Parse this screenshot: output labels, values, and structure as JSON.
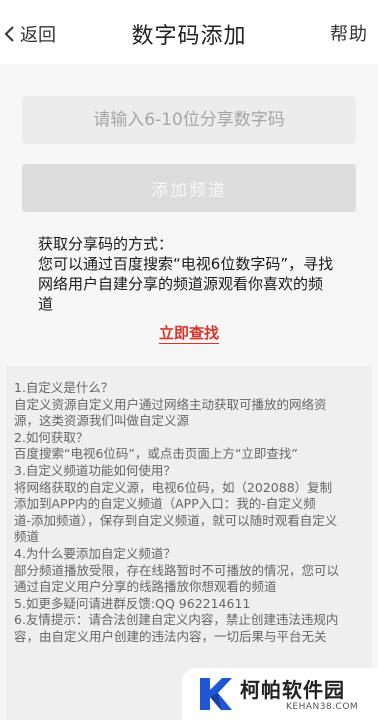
{
  "header": {
    "back_label": "返回",
    "title": "数字码添加",
    "help_label": "帮助"
  },
  "code_input": {
    "placeholder": "请输入6-10位分享数字码",
    "value": ""
  },
  "add_button": {
    "label": "添加频道"
  },
  "howto": {
    "lines": [
      "获取分享码的方式：",
      "您可以通过百度搜索“电视6位数字码”，寻找",
      "网络用户自建分享的频道源观看你喜欢的频",
      "道"
    ],
    "find_link": "立即查找"
  },
  "faq": {
    "lines": [
      "1.自定义是什么？",
      "自定义资源自定义用户通过网络主动获取可播放的网络资",
      "源，这类资源我们叫做自定义源",
      "2.如何获取？",
      "百度搜索“电视6位码”，或点击页面上方“立即查找”",
      "3.自定义频道功能如何使用？",
      "将网络获取的自定义源，电视6位码，如（202088）复制",
      "添加到APP内的自定义频道（APP入口：我的-自定义频",
      "道-添加频道），保存到自定义频道，就可以随时观看自定义",
      "频道",
      "4.为什么要添加自定义频道？",
      "部分频道播放受限，存在线路暂时不可播放的情况，您可以",
      "通过自定义用户分享的线路播放你想观看的频道",
      "5.如更多疑问请进群反馈:QQ 962214611",
      "6.友情提示：请合法创建自定义内容，禁止创建违法违规内",
      "容，由自定义用户创建的违法内容，一切后果与平台无关"
    ]
  },
  "watermark": {
    "name": "柯帕软件园",
    "url": "KEHAN38.COM",
    "color": "#1f56d6"
  },
  "colors": {
    "link_red": "#d9362b",
    "page_bg": "#f6f6f6"
  }
}
